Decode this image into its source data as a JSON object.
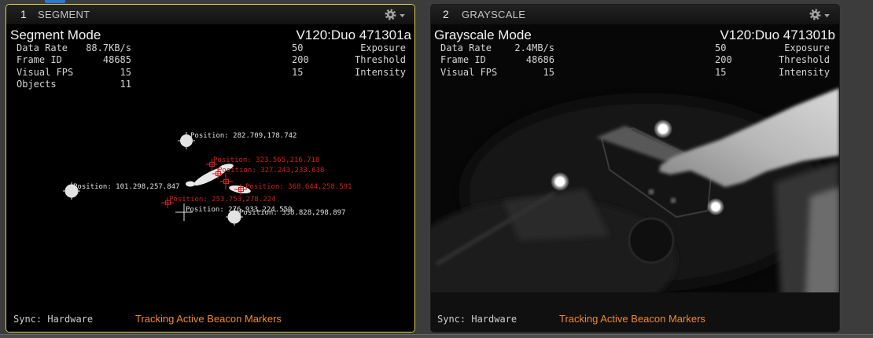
{
  "colors": {
    "selected_border": "#e0d24a",
    "tracking_text": "#f08a2a",
    "marker_white": "#e2e2e2",
    "marker_red": "#d21f1f"
  },
  "panels": [
    {
      "index": "1",
      "title": "SEGMENT",
      "selected": true,
      "header_icons": [
        "gear-icon",
        "chevron-down-icon"
      ],
      "mode": "Segment Mode",
      "camera": "V120:Duo 471301a",
      "stats": [
        {
          "label": "Data Rate",
          "value": "88.7KB/s"
        },
        {
          "label": "Frame ID",
          "value": "48685"
        },
        {
          "label": "Visual FPS",
          "value": "15"
        },
        {
          "label": "Objects",
          "value": "11"
        }
      ],
      "settings": [
        {
          "value": "50",
          "label": "Exposure"
        },
        {
          "value": "200",
          "label": "Threshold"
        },
        {
          "value": "15",
          "label": "Intensity"
        }
      ],
      "sync": "Sync: Hardware",
      "tracking": "Tracking Active Beacon Markers",
      "markers": [
        {
          "label": "Position: 282.709,178.742",
          "color": "#e2e2e2"
        },
        {
          "label": "Position: 101.298,257.847",
          "color": "#e2e2e2"
        },
        {
          "label": "Position: 338.828,298.897",
          "color": "#e2e2e2"
        },
        {
          "label": "Position: 276.933,224.559",
          "color": "#e2e2e2"
        },
        {
          "label": "Position: 323.565,216.718",
          "color": "#d21f1f"
        },
        {
          "label": "Position: 327.243,233.638",
          "color": "#d21f1f"
        },
        {
          "label": "Position: 368.644,258.591",
          "color": "#d21f1f"
        },
        {
          "label": "Position: 253.753,278.224",
          "color": "#d21f1f"
        }
      ]
    },
    {
      "index": "2",
      "title": "GRAYSCALE",
      "selected": false,
      "header_icons": [
        "gear-icon",
        "chevron-down-icon"
      ],
      "mode": "Grayscale Mode",
      "camera": "V120:Duo 471301b",
      "stats": [
        {
          "label": "Data Rate",
          "value": "2.4MB/s"
        },
        {
          "label": "Frame ID",
          "value": "48686"
        },
        {
          "label": "Visual FPS",
          "value": "15"
        }
      ],
      "settings": [
        {
          "value": "50",
          "label": "Exposure"
        },
        {
          "value": "200",
          "label": "Threshold"
        },
        {
          "value": "15",
          "label": "Intensity"
        }
      ],
      "sync": "Sync: Hardware",
      "tracking": "Tracking Active Beacon Markers"
    }
  ]
}
